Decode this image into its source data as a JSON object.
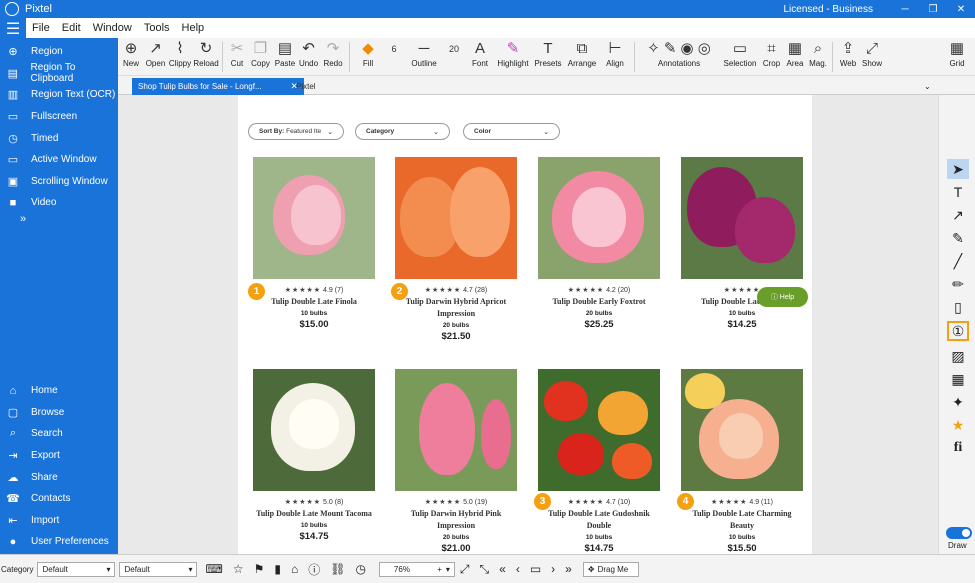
{
  "window": {
    "title": "Pixtel",
    "license": "Licensed - Business"
  },
  "menubar": [
    "File",
    "Edit",
    "Window",
    "Tools",
    "Help"
  ],
  "sidebar": {
    "capture": [
      {
        "label": "Region",
        "icon": "region-icon"
      },
      {
        "label": "Region To Clipboard",
        "icon": "clipboard-icon"
      },
      {
        "label": "Region Text (OCR)",
        "icon": "ocr-icon"
      },
      {
        "label": "Fullscreen",
        "icon": "fullscreen-icon"
      },
      {
        "label": "Timed",
        "icon": "timer-icon"
      },
      {
        "label": "Active Window",
        "icon": "window-icon"
      },
      {
        "label": "Scrolling Window",
        "icon": "scroll-window-icon"
      },
      {
        "label": "Video",
        "icon": "video-icon"
      }
    ],
    "more": "»",
    "nav": [
      {
        "label": "Home",
        "icon": "home-icon"
      },
      {
        "label": "Browse",
        "icon": "browse-icon"
      },
      {
        "label": "Search",
        "icon": "search-icon"
      },
      {
        "label": "Export",
        "icon": "export-icon"
      },
      {
        "label": "Share",
        "icon": "share-icon"
      },
      {
        "label": "Contacts",
        "icon": "contacts-icon"
      },
      {
        "label": "Import",
        "icon": "import-icon"
      },
      {
        "label": "User Preferences",
        "icon": "user-icon"
      }
    ]
  },
  "toolbar": {
    "new": "New",
    "open": "Open",
    "clippy": "Clippy",
    "reload": "Reload",
    "cut": "Cut",
    "copy": "Copy",
    "paste": "Paste",
    "undo": "Undo",
    "redo": "Redo",
    "fill": "Fill",
    "outline": "Outline",
    "outline_width": "6",
    "font_size": "20",
    "font": "Font",
    "highlight": "Highlight",
    "presets": "Presets",
    "arrange": "Arrange",
    "align": "Align",
    "annotations": "Annotations",
    "selection": "Selection",
    "crop": "Crop",
    "area": "Area",
    "mag": "Mag.",
    "web": "Web",
    "show": "Show",
    "grid": "Grid"
  },
  "tabs": {
    "active": "Shop Tulip Bulbs for Sale - Longf...",
    "other": "Pixtel"
  },
  "filters": {
    "sort_label": "Sort By:",
    "sort_value": "Featured Ite",
    "category": "Category",
    "color": "Color"
  },
  "products": [
    {
      "name": "Tulip Double Late Finola",
      "rating": "4.9",
      "reviews": "(7)",
      "bulbs": "10 bulbs",
      "price": "$15.00",
      "marker": "1"
    },
    {
      "name": "Tulip Darwin Hybrid Apricot Impression",
      "rating": "4.7",
      "reviews": "(28)",
      "bulbs": "20 bulbs",
      "price": "$21.50",
      "marker": "2"
    },
    {
      "name": "Tulip Double Early Foxtrot",
      "rating": "4.2",
      "reviews": "(20)",
      "bulbs": "20 bulbs",
      "price": "$25.25",
      "marker": ""
    },
    {
      "name": "Tulip Double Late Ne",
      "rating": "",
      "reviews": "",
      "bulbs": "10 bulbs",
      "price": "$14.25",
      "marker": ""
    },
    {
      "name": "Tulip Double Late Mount Tacoma",
      "rating": "5.0",
      "reviews": "(8)",
      "bulbs": "10 bulbs",
      "price": "$14.75",
      "marker": ""
    },
    {
      "name": "Tulip Darwin Hybrid Pink Impression",
      "rating": "5.0",
      "reviews": "(19)",
      "bulbs": "20 bulbs",
      "price": "$21.00",
      "marker": ""
    },
    {
      "name": "Tulip Double Late Gudoshnik Double",
      "rating": "4.7",
      "reviews": "(10)",
      "bulbs": "10 bulbs",
      "price": "$14.75",
      "marker": "3"
    },
    {
      "name": "Tulip Double Late Charming Beauty",
      "rating": "4.9",
      "reviews": "(11)",
      "bulbs": "10 bulbs",
      "price": "$15.50",
      "marker": "4"
    }
  ],
  "help_button": "Help",
  "right_tools": {
    "draw": "Draw",
    "font_icon": "fi"
  },
  "statusbar": {
    "category_label": "Category",
    "category_value": "Default",
    "style_value": "Default",
    "zoom": "76%",
    "drag": "Drag Me"
  },
  "colors": {
    "accent": "#1a73d9",
    "marker": "#f4a011",
    "help": "#6a9e2a"
  }
}
